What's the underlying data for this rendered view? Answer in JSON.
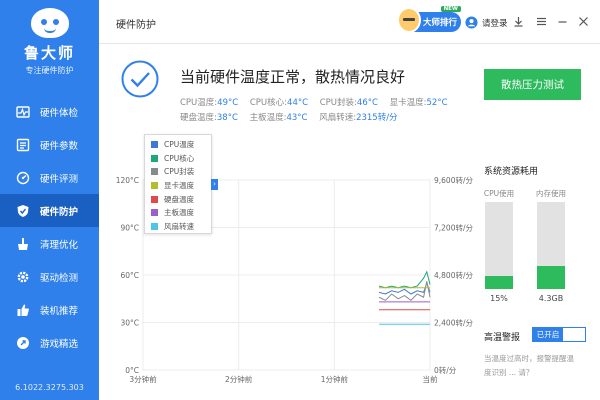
{
  "app": {
    "brand": "鲁大师",
    "tagline": "专注硬件防护",
    "version": "6.1022.3275.303"
  },
  "sidebar": {
    "items": [
      {
        "label": "硬件体检",
        "icon": "pulse-icon"
      },
      {
        "label": "硬件参数",
        "icon": "list-icon"
      },
      {
        "label": "硬件评测",
        "icon": "gauge-icon"
      },
      {
        "label": "硬件防护",
        "icon": "shield-icon",
        "active": true
      },
      {
        "label": "清理优化",
        "icon": "broom-icon"
      },
      {
        "label": "驱动检测",
        "icon": "gear-icon"
      },
      {
        "label": "装机推荐",
        "icon": "thumb-icon"
      },
      {
        "label": "游戏精选",
        "icon": "rocket-icon"
      }
    ]
  },
  "titlebar": {
    "title": "硬件防护",
    "rank_label": "大师排行",
    "new_badge": "NEW",
    "login_label": "请登录"
  },
  "status": {
    "title": "当前硬件温度正常，散热情况良好",
    "readings_row1": [
      {
        "label": "CPU温度:",
        "value": "49°C"
      },
      {
        "label": "CPU核心:",
        "value": "44°C"
      },
      {
        "label": "CPU封装:",
        "value": "46°C"
      },
      {
        "label": "显卡温度:",
        "value": "52°C"
      }
    ],
    "readings_row2": [
      {
        "label": "硬盘温度:",
        "value": "38°C"
      },
      {
        "label": "主板温度:",
        "value": "43°C"
      },
      {
        "label": "风扇转速:",
        "value": "2315转/分"
      }
    ],
    "stress_button": "散热压力测试"
  },
  "legend": {
    "items": [
      {
        "label": "CPU温度",
        "color": "#3b78d8"
      },
      {
        "label": "CPU核心",
        "color": "#1fa67a"
      },
      {
        "label": "CPU封装",
        "color": "#8a8a8a"
      },
      {
        "label": "显卡温度",
        "color": "#b5bd2c"
      },
      {
        "label": "硬盘温度",
        "color": "#e04a4a"
      },
      {
        "label": "主板温度",
        "color": "#9b5fc9"
      },
      {
        "label": "风扇转速",
        "color": "#4fc3e8"
      }
    ],
    "toggle_glyph": "›"
  },
  "chart_data": {
    "type": "line",
    "y_left_ticks": [
      "120°C",
      "90°C",
      "60°C",
      "30°C",
      "0°C"
    ],
    "y_right_ticks": [
      "9,600转/分",
      "7,200转/分",
      "4,800转/分",
      "2,400转/分",
      "0转/分"
    ],
    "x_ticks": [
      "3分钟前",
      "2分钟前",
      "1分钟前",
      "当前"
    ],
    "ylim_left": [
      0,
      120
    ],
    "ylim_right": [
      0,
      9600
    ],
    "x_range": [
      -180,
      0
    ],
    "grid": true,
    "series": [
      {
        "name": "CPU温度",
        "axis": "left",
        "color": "#3b78d8",
        "x": [
          -32,
          -28,
          -24,
          -20,
          -16,
          -12,
          -8,
          -4,
          -2,
          0
        ],
        "values": [
          49,
          48,
          50,
          49,
          51,
          48,
          50,
          49,
          55,
          49
        ]
      },
      {
        "name": "CPU核心",
        "axis": "left",
        "color": "#1fa67a",
        "x": [
          -32,
          -28,
          -24,
          -20,
          -16,
          -12,
          -8,
          -4,
          -2,
          0
        ],
        "values": [
          53,
          52,
          53,
          52,
          53,
          52,
          53,
          58,
          62,
          54
        ]
      },
      {
        "name": "CPU封装",
        "axis": "left",
        "color": "#8a8a8a",
        "x": [
          -32,
          -28,
          -24,
          -20,
          -16,
          -12,
          -8,
          -4,
          -2,
          0
        ],
        "values": [
          46,
          44,
          48,
          45,
          47,
          44,
          48,
          46,
          56,
          46
        ]
      },
      {
        "name": "显卡温度",
        "axis": "left",
        "color": "#b5bd2c",
        "x": [
          -32,
          -28,
          -24,
          -20,
          -16,
          -12,
          -8,
          -4,
          -2,
          0
        ],
        "values": [
          52,
          52,
          52,
          52,
          52,
          52,
          52,
          52,
          52,
          52
        ]
      },
      {
        "name": "硬盘温度",
        "axis": "left",
        "color": "#e04a4a",
        "x": [
          -32,
          -28,
          -24,
          -20,
          -16,
          -12,
          -8,
          -4,
          -2,
          0
        ],
        "values": [
          38,
          38,
          38,
          38,
          38,
          38,
          38,
          38,
          38,
          38
        ]
      },
      {
        "name": "主板温度",
        "axis": "left",
        "color": "#9b5fc9",
        "x": [
          -32,
          -28,
          -24,
          -20,
          -16,
          -12,
          -8,
          -4,
          -2,
          0
        ],
        "values": [
          43,
          43,
          43,
          43,
          43,
          43,
          43,
          43,
          43,
          43
        ]
      },
      {
        "name": "风扇转速",
        "axis": "right",
        "color": "#4fc3e8",
        "x": [
          -32,
          -28,
          -24,
          -20,
          -16,
          -12,
          -8,
          -4,
          -2,
          0
        ],
        "values": [
          2315,
          2315,
          2315,
          2315,
          2315,
          2315,
          2315,
          2315,
          2315,
          2315
        ]
      }
    ]
  },
  "resources": {
    "title": "系统资源耗用",
    "cpu_label": "CPU使用",
    "cpu_value": "15%",
    "cpu_fraction": 0.15,
    "mem_label": "内存使用",
    "mem_value": "4.3GB",
    "mem_fraction": 0.27
  },
  "alarm": {
    "label": "高温警报",
    "state": "已开启",
    "description": "当温度过高时，报警提醒温度识别 ... 请？"
  }
}
